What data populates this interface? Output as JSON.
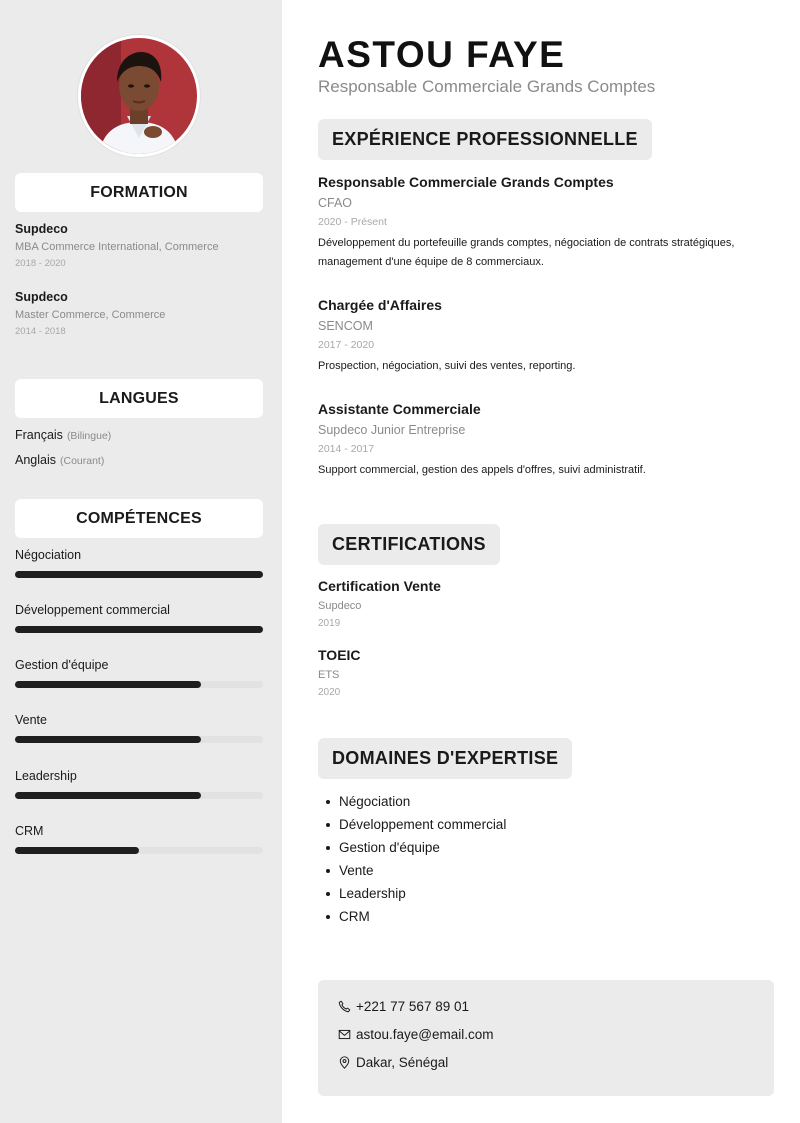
{
  "profile": {
    "name": "ASTOU FAYE",
    "title": "Responsable Commerciale Grands Comptes"
  },
  "sidebar": {
    "formation_heading": "FORMATION",
    "education": [
      {
        "school": "Supdeco",
        "degree": "MBA Commerce International, Commerce",
        "years": "2018 - 2020"
      },
      {
        "school": "Supdeco",
        "degree": "Master Commerce, Commerce",
        "years": "2014 - 2018"
      }
    ],
    "languages_heading": "LANGUES",
    "languages": [
      {
        "name": "Français",
        "level": "(Bilingue)"
      },
      {
        "name": "Anglais",
        "level": "(Courant)"
      }
    ],
    "skills_heading": "COMPÉTENCES",
    "skills": [
      {
        "name": "Négociation",
        "level": 1.0
      },
      {
        "name": "Développement commercial",
        "level": 1.0
      },
      {
        "name": "Gestion d'équipe",
        "level": 0.75
      },
      {
        "name": "Vente",
        "level": 0.75
      },
      {
        "name": "Leadership",
        "level": 0.75
      },
      {
        "name": "CRM",
        "level": 0.5
      }
    ]
  },
  "experience": {
    "heading": "EXPÉRIENCE PROFESSIONNELLE",
    "jobs": [
      {
        "title": "Responsable Commerciale Grands Comptes",
        "company": "CFAO",
        "period": "2020 - Présent",
        "description": "Développement du portefeuille grands comptes, négociation de contrats stratégiques, management d'une équipe de 8 commerciaux."
      },
      {
        "title": "Chargée d'Affaires",
        "company": "SENCOM",
        "period": "2017 - 2020",
        "description": "Prospection, négociation, suivi des ventes, reporting."
      },
      {
        "title": "Assistante Commerciale",
        "company": "Supdeco Junior Entreprise",
        "period": "2014 - 2017",
        "description": "Support commercial, gestion des appels d'offres, suivi administratif."
      }
    ]
  },
  "certifications": {
    "heading": "CERTIFICATIONS",
    "items": [
      {
        "name": "Certification Vente",
        "issuer": "Supdeco",
        "year": "2019"
      },
      {
        "name": "TOEIC",
        "issuer": "ETS",
        "year": "2020"
      }
    ]
  },
  "expertise": {
    "heading": "DOMAINES D'EXPERTISE",
    "items": [
      "Négociation",
      "Développement commercial",
      "Gestion d'équipe",
      "Vente",
      "Leadership",
      "CRM"
    ]
  },
  "contact": {
    "phone": "+221 77 567 89 01",
    "email": "astou.faye@email.com",
    "location": "Dakar, Sénégal",
    "icons": {
      "phone": "phone-icon",
      "email": "mail-icon",
      "location": "location-pin-icon"
    }
  },
  "colors": {
    "sidebar_bg": "#ebebeb",
    "heading_bg": "#ebebeb",
    "bar_fill": "#1f1f1f",
    "bar_track": "#e2e2e2",
    "muted_text": "#8a8a8a"
  }
}
